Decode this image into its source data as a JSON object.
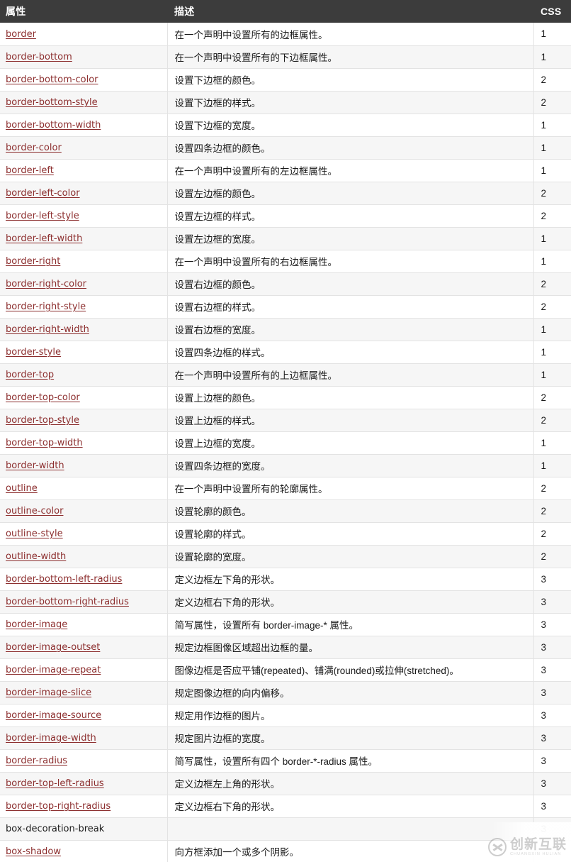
{
  "table": {
    "columns": [
      {
        "key": "property",
        "label": "属性"
      },
      {
        "key": "description",
        "label": "描述"
      },
      {
        "key": "css",
        "label": "CSS"
      }
    ],
    "link_color": "#8c2e2e",
    "header_background": "#3c3c3c",
    "header_text_color": "#ffffff",
    "stripe_color": "#f6f6f6",
    "rows": [
      {
        "property": "border",
        "is_link": true,
        "description": "在一个声明中设置所有的边框属性。",
        "css": "1"
      },
      {
        "property": "border-bottom",
        "is_link": true,
        "description": "在一个声明中设置所有的下边框属性。",
        "css": "1"
      },
      {
        "property": "border-bottom-color",
        "is_link": true,
        "description": "设置下边框的颜色。",
        "css": "2"
      },
      {
        "property": "border-bottom-style",
        "is_link": true,
        "description": "设置下边框的样式。",
        "css": "2"
      },
      {
        "property": "border-bottom-width",
        "is_link": true,
        "description": "设置下边框的宽度。",
        "css": "1"
      },
      {
        "property": "border-color",
        "is_link": true,
        "description": "设置四条边框的颜色。",
        "css": "1"
      },
      {
        "property": "border-left",
        "is_link": true,
        "description": "在一个声明中设置所有的左边框属性。",
        "css": "1"
      },
      {
        "property": "border-left-color",
        "is_link": true,
        "description": "设置左边框的颜色。",
        "css": "2"
      },
      {
        "property": "border-left-style",
        "is_link": true,
        "description": "设置左边框的样式。",
        "css": "2"
      },
      {
        "property": "border-left-width",
        "is_link": true,
        "description": "设置左边框的宽度。",
        "css": "1"
      },
      {
        "property": "border-right",
        "is_link": true,
        "description": "在一个声明中设置所有的右边框属性。",
        "css": "1"
      },
      {
        "property": "border-right-color",
        "is_link": true,
        "description": "设置右边框的颜色。",
        "css": "2"
      },
      {
        "property": "border-right-style",
        "is_link": true,
        "description": "设置右边框的样式。",
        "css": "2"
      },
      {
        "property": "border-right-width",
        "is_link": true,
        "description": "设置右边框的宽度。",
        "css": "1"
      },
      {
        "property": "border-style",
        "is_link": true,
        "description": "设置四条边框的样式。",
        "css": "1"
      },
      {
        "property": "border-top",
        "is_link": true,
        "description": "在一个声明中设置所有的上边框属性。",
        "css": "1"
      },
      {
        "property": "border-top-color",
        "is_link": true,
        "description": "设置上边框的颜色。",
        "css": "2"
      },
      {
        "property": "border-top-style",
        "is_link": true,
        "description": "设置上边框的样式。",
        "css": "2"
      },
      {
        "property": "border-top-width",
        "is_link": true,
        "description": "设置上边框的宽度。",
        "css": "1"
      },
      {
        "property": "border-width",
        "is_link": true,
        "description": "设置四条边框的宽度。",
        "css": "1"
      },
      {
        "property": "outline",
        "is_link": true,
        "description": "在一个声明中设置所有的轮廓属性。",
        "css": "2"
      },
      {
        "property": "outline-color",
        "is_link": true,
        "description": "设置轮廓的颜色。",
        "css": "2"
      },
      {
        "property": "outline-style",
        "is_link": true,
        "description": "设置轮廓的样式。",
        "css": "2"
      },
      {
        "property": "outline-width",
        "is_link": true,
        "description": "设置轮廓的宽度。",
        "css": "2"
      },
      {
        "property": "border-bottom-left-radius",
        "is_link": true,
        "description": "定义边框左下角的形状。",
        "css": "3"
      },
      {
        "property": "border-bottom-right-radius",
        "is_link": true,
        "description": "定义边框右下角的形状。",
        "css": "3"
      },
      {
        "property": "border-image",
        "is_link": true,
        "description": "简写属性，设置所有 border-image-* 属性。",
        "css": "3"
      },
      {
        "property": "border-image-outset",
        "is_link": true,
        "description": "规定边框图像区域超出边框的量。",
        "css": "3"
      },
      {
        "property": "border-image-repeat",
        "is_link": true,
        "description": "图像边框是否应平铺(repeated)、铺满(rounded)或拉伸(stretched)。",
        "css": "3"
      },
      {
        "property": "border-image-slice",
        "is_link": true,
        "description": "规定图像边框的向内偏移。",
        "css": "3"
      },
      {
        "property": "border-image-source",
        "is_link": true,
        "description": "规定用作边框的图片。",
        "css": "3"
      },
      {
        "property": "border-image-width",
        "is_link": true,
        "description": "规定图片边框的宽度。",
        "css": "3"
      },
      {
        "property": "border-radius",
        "is_link": true,
        "description": "简写属性，设置所有四个 border-*-radius 属性。",
        "css": "3"
      },
      {
        "property": "border-top-left-radius",
        "is_link": true,
        "description": "定义边框左上角的形状。",
        "css": "3"
      },
      {
        "property": "border-top-right-radius",
        "is_link": true,
        "description": "定义边框右下角的形状。",
        "css": "3"
      },
      {
        "property": "box-decoration-break",
        "is_link": false,
        "description": "",
        "css": "3"
      },
      {
        "property": "box-shadow",
        "is_link": true,
        "description": "向方框添加一个或多个阴影。",
        "css": ""
      }
    ]
  },
  "watermark": {
    "logo_icon": "circle-x-logo-icon",
    "brand_cn": "创新互联",
    "brand_en": "CHUANGXIN HULIAN"
  }
}
